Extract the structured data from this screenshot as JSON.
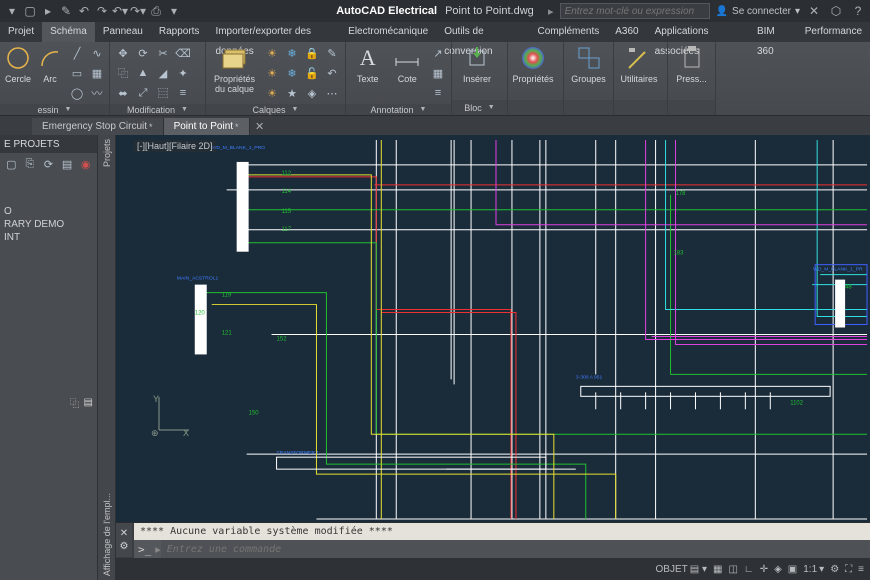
{
  "title": {
    "app": "AutoCAD Electrical",
    "doc": "Point to Point.dwg"
  },
  "search": {
    "placeholder": "Entrez mot-clé ou expression"
  },
  "signin": {
    "label": "Se connecter"
  },
  "ribbon_tabs": [
    "Projet",
    "Schéma",
    "Panneau",
    "Rapports",
    "Importer/exporter des données",
    "Electromécanique",
    "Outils de conversion",
    "Compléments",
    "A360",
    "Applications associées",
    "BIM 360",
    "Performance"
  ],
  "ribbon": {
    "panels": {
      "dessin": {
        "title": "essin",
        "btn1": "Cercle",
        "btn2": "Arc"
      },
      "modification": {
        "title": "Modification"
      },
      "calques": {
        "title": "Calques",
        "btn": "Propriétés du calque"
      },
      "annotation": {
        "title": "Annotation",
        "btn1": "Texte",
        "btn2": "Cote"
      },
      "bloc": {
        "title": "Bloc",
        "btn": "Insérer"
      },
      "proprietes": {
        "title": "",
        "btn": "Propriétés"
      },
      "groupes": {
        "title": "",
        "btn": "Groupes"
      },
      "utilitaires": {
        "title": "",
        "btn": "Utilitaires"
      },
      "presse": {
        "title": "",
        "btn": "Press..."
      }
    }
  },
  "doc_tabs": [
    {
      "label": "Emergency Stop Circuit",
      "dirty": true,
      "active": false
    },
    {
      "label": "Point to Point",
      "dirty": true,
      "active": true
    }
  ],
  "projects_panel": {
    "title": "E PROJETS",
    "items": [
      "O",
      "RARY DEMO",
      "INT"
    ]
  },
  "side_labels": {
    "top": "Affichage de l'empl...",
    "bottom": "Projets"
  },
  "viewport_label": "[-][Haut][Filaire 2D]",
  "command": {
    "history": "**** Aucune variable système modifiée ****",
    "prompt": ">_",
    "placeholder": "Entrez une commande"
  },
  "status": {
    "objet": "OBJET",
    "scale": "1:1"
  },
  "wire_labels": [
    "112",
    "114",
    "115",
    "117",
    "119",
    "120",
    "121",
    "150",
    "152",
    "178",
    "183",
    "1102",
    "48"
  ],
  "text_labels": [
    "WD_M_BLANK_1_PRO",
    "MAIN_ACSTROL1",
    "TRANSFORMER 1",
    "3-300 A 951",
    "WD_M_BLANK_1_PR"
  ]
}
